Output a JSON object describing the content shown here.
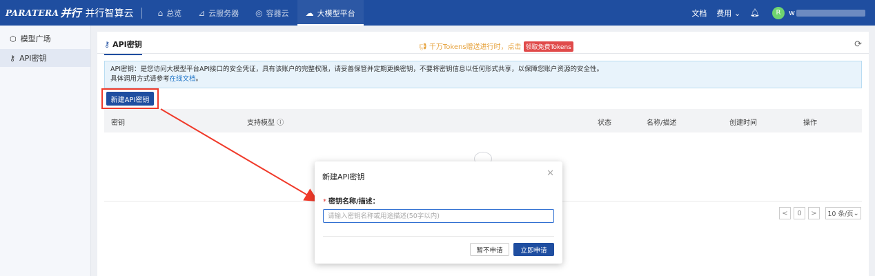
{
  "topbar": {
    "brand_logo": "PARATERA",
    "brand_cn": "并行",
    "brand_name": "并行智算云",
    "nav": [
      {
        "label": "总览",
        "icon": "home-icon"
      },
      {
        "label": "云服务器",
        "icon": "server-icon"
      },
      {
        "label": "容器云",
        "icon": "container-icon"
      },
      {
        "label": "大模型平台",
        "icon": "cloud-icon"
      }
    ],
    "docs": "文档",
    "billing": "费用",
    "avatar_initial": "R",
    "user_name": "w"
  },
  "sidebar": {
    "items": [
      {
        "label": "模型广场",
        "icon": "cube-icon"
      },
      {
        "label": "API密钥",
        "icon": "key-icon"
      }
    ]
  },
  "main": {
    "tab_label": "API密钥",
    "promo_text": "千万Tokens赠送进行时，点击",
    "promo_badge": "领取免费Tokens",
    "alert_line1": "API密钥：是您访问大模型平台API接口的安全凭证，具有该账户的完整权限，请妥善保管并定期更换密钥，不要将密钥信息以任何形式共享，以保障您账户资源的安全性。",
    "alert_line2_prefix": "具体调用方式请参考",
    "alert_link": "在线文档",
    "alert_line2_suffix": "。",
    "new_button": "新建API密钥",
    "table_headers": {
      "key": "密钥",
      "models": "支持模型",
      "status": "状态",
      "name": "名称/描述",
      "created": "创建时间",
      "actions": "操作"
    },
    "pager": {
      "prev": "<",
      "page": "0",
      "next": ">",
      "size": "10 条/页"
    }
  },
  "modal": {
    "title": "新建API密钥",
    "field_label": "密钥名称/描述：",
    "required_mark": "*",
    "placeholder": "请输入密钥名称或用途描述(50字以内)",
    "cancel": "暂不申请",
    "submit": "立即申请"
  },
  "colors": {
    "brand": "#1f4ea0",
    "highlight": "#f03a2a",
    "promo": "#e6a23c"
  }
}
